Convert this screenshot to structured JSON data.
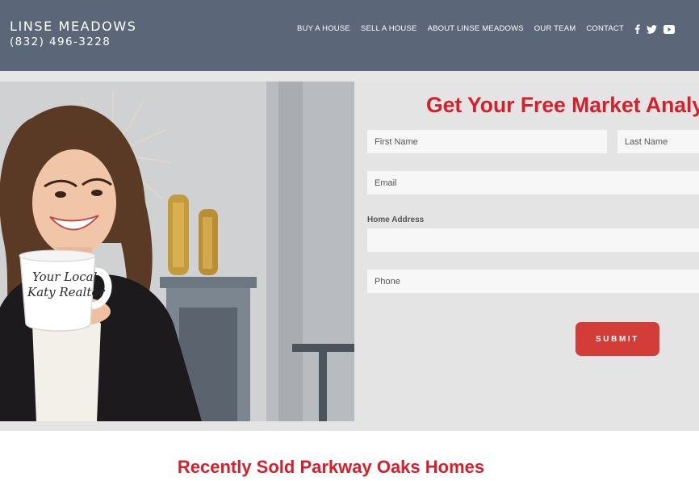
{
  "header": {
    "brand_name": "LINSE MEADOWS",
    "phone": "(832) 496-3228",
    "nav": [
      {
        "label": "BUY A HOUSE"
      },
      {
        "label": "SELL A HOUSE"
      },
      {
        "label": "ABOUT LINSE MEADOWS"
      },
      {
        "label": "OUR TEAM"
      },
      {
        "label": "CONTACT"
      }
    ],
    "social": [
      "facebook-icon",
      "twitter-icon",
      "youtube-icon"
    ]
  },
  "hero": {
    "mug_text_line1": "Your Local",
    "mug_text_line2": "Katy Realtor"
  },
  "form": {
    "title": "Get Your Free Market Analysis",
    "first_name_placeholder": "First Name",
    "last_name_placeholder": "Last Name",
    "email_placeholder": "Email",
    "home_address_label": "Home Address",
    "home_address_value": "",
    "phone_placeholder": "Phone",
    "submit_label": "SUBMIT"
  },
  "section": {
    "title": "Recently Sold Parkway Oaks Homes"
  },
  "colors": {
    "header_bg": "#5b6778",
    "accent_red": "#d3202a",
    "button_red": "#d43c37",
    "hero_bg": "#e4e4e4"
  }
}
